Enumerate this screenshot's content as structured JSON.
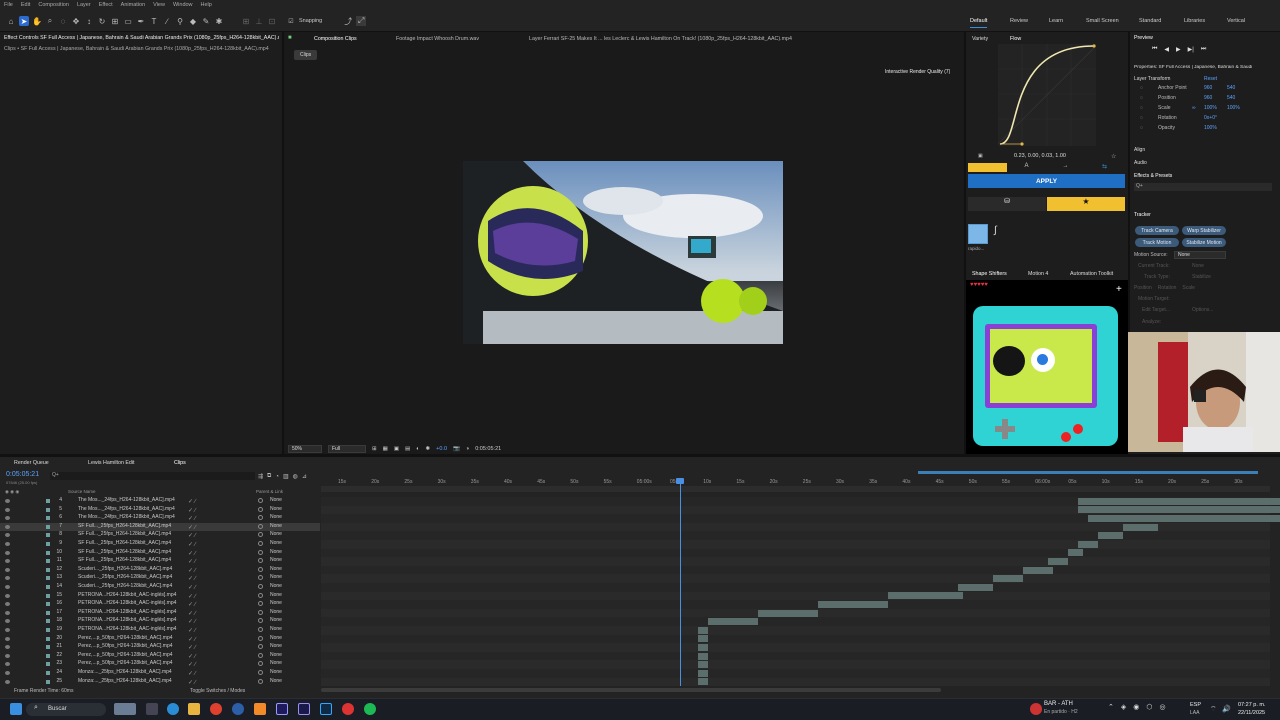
{
  "menu": [
    "File",
    "Edit",
    "Composition",
    "Layer",
    "Effect",
    "Animation",
    "View",
    "Window",
    "Help"
  ],
  "toolbar": {
    "snapping": "Snapping"
  },
  "workspaces": [
    "Default",
    "Review",
    "Learn",
    "Small Screen",
    "Standard",
    "Libraries",
    "Vertical"
  ],
  "effect_controls": {
    "tab": "Effect Controls SF Full Access | Japanese, Bahrain & Saudi Arabian Grands Prix (1080p_25fps_H264-128kbit_AAC).mp4",
    "path": "Clips • SF Full Access | Japanese, Bahrain & Saudi Arabian Grands Prix (1080p_25fps_H264-128kbit_AAC).mp4"
  },
  "viewer": {
    "tabs": [
      "Composition Clips",
      "Footage Impact Whoosh Drum.wav",
      "Layer Ferrari SF-25 Makes It ... les Leclerc & Lewis Hamilton On Track! (1080p_25fps_H264-128kbit_AAC).mp4"
    ],
    "breadcrumb": "Clips",
    "render_quality": "Interactive Render Quality (7)",
    "zoom": "50%",
    "resolution": "Full",
    "timecode": "0:05:05:21",
    "exposure": "+0.0"
  },
  "flow": {
    "tabs": [
      "Variety",
      "Flow"
    ],
    "values": "0.23, 0.00, 0.03, 1.00",
    "apply": "APPLY",
    "preset_label": "rapido..."
  },
  "preview": {
    "title": "Preview"
  },
  "properties": {
    "title": "Properties: SF Full Access | Japanese, Bahrain & Saudi",
    "section": "Layer Transform",
    "reset": "Reset",
    "rows": [
      {
        "label": "Anchor Point",
        "v1": "960",
        "v2": "540"
      },
      {
        "label": "Position",
        "v1": "960",
        "v2": "540"
      },
      {
        "label": "Scale",
        "v1": "100%",
        "v2": "100%"
      },
      {
        "label": "Rotation",
        "v1": "0x+0°",
        "v2": ""
      },
      {
        "label": "Opacity",
        "v1": "100%",
        "v2": ""
      }
    ],
    "align": "Align",
    "audio": "Audio",
    "effects_presets": "Effects & Presets",
    "search_placeholder": "Q+"
  },
  "tracker": {
    "title": "Tracker",
    "buttons": [
      "Track Camera",
      "Warp Stabilizer",
      "Track Motion",
      "Stabilize Motion"
    ],
    "motion_source_label": "Motion Source:",
    "motion_source": "None",
    "current_track_label": "Current Track:",
    "current_track": "None",
    "track_type_label": "Track Type:",
    "track_type": "Stabilize",
    "options": [
      "Position",
      "Rotation",
      "Scale"
    ],
    "motion_target": "Motion Target:",
    "edit_target": "Edit Target...",
    "options_btn": "Options...",
    "analyze": "Analyze:"
  },
  "lower_tabs": [
    "Shape Shifters",
    "Motion 4",
    "Automation Toolkit"
  ],
  "timeline": {
    "tabs": [
      "Render Queue",
      "Lewis Hamilton Edit",
      "Clips"
    ],
    "timecode": "0:05:05:21",
    "timecode_sub": "07646 (25.00 fps)",
    "search_placeholder": "Q+",
    "col_source": "Source Name",
    "col_parent": "Parent & Link",
    "ruler": [
      "15s",
      "20s",
      "25s",
      "30s",
      "35s",
      "40s",
      "45s",
      "50s",
      "55s",
      "05:00s",
      "05s",
      "10s",
      "15s",
      "20s",
      "25s",
      "30s",
      "35s",
      "40s",
      "45s",
      "50s",
      "55s",
      "06:00s",
      "05s",
      "10s",
      "15s",
      "20s",
      "25s",
      "30s"
    ],
    "layers": [
      {
        "n": "4",
        "name": "The Mos..._24fps_H264-128kbit_AAC].mp4",
        "parent": "None"
      },
      {
        "n": "5",
        "name": "The Mos..._24fps_H264-128kbit_AAC].mp4",
        "parent": "None"
      },
      {
        "n": "6",
        "name": "The Mos..._24fps_H264-128kbit_AAC].mp4",
        "parent": "None"
      },
      {
        "n": "7",
        "name": "SF Full..._25fps_H264-128kbit_AAC].mp4",
        "parent": "None"
      },
      {
        "n": "8",
        "name": "SF Full..._25fps_H264-128kbit_AAC].mp4",
        "parent": "None"
      },
      {
        "n": "9",
        "name": "SF Full..._25fps_H264-128kbit_AAC].mp4",
        "parent": "None"
      },
      {
        "n": "10",
        "name": "SF Full..._25fps_H264-128kbit_AAC].mp4",
        "parent": "None"
      },
      {
        "n": "11",
        "name": "SF Full..._25fps_H264-128kbit_AAC].mp4",
        "parent": "None"
      },
      {
        "n": "12",
        "name": "Scuderi..._25fps_H264-128kbit_AAC].mp4",
        "parent": "None"
      },
      {
        "n": "13",
        "name": "Scuderi..._25fps_H264-128kbit_AAC].mp4",
        "parent": "None"
      },
      {
        "n": "14",
        "name": "Scuderi..._25fps_H264-128kbit_AAC].mp4",
        "parent": "None"
      },
      {
        "n": "15",
        "name": "PETRONA...H264-128kbit_AAC-inglés].mp4",
        "parent": "None"
      },
      {
        "n": "16",
        "name": "PETRONA...H264-128kbit_AAC-inglés].mp4",
        "parent": "None"
      },
      {
        "n": "17",
        "name": "PETRONA...H264-128kbit_AAC-inglés].mp4",
        "parent": "None"
      },
      {
        "n": "18",
        "name": "PETRONA...H264-128kbit_AAC-inglés].mp4",
        "parent": "None"
      },
      {
        "n": "19",
        "name": "PETRONA...H264-128kbit_AAC-inglés].mp4",
        "parent": "None"
      },
      {
        "n": "20",
        "name": "Perez,...p_50fps_H264-128kbit_AAC].mp4",
        "parent": "None"
      },
      {
        "n": "21",
        "name": "Perez,...p_50fps_H264-128kbit_AAC].mp4",
        "parent": "None"
      },
      {
        "n": "22",
        "name": "Perez,...p_50fps_H264-128kbit_AAC].mp4",
        "parent": "None"
      },
      {
        "n": "23",
        "name": "Perez,...p_50fps_H264-128kbit_AAC].mp4",
        "parent": "None"
      },
      {
        "n": "24",
        "name": "Monza:..._25fps_H264-128kbit_AAC].mp4",
        "parent": "None"
      },
      {
        "n": "25",
        "name": "Monza:..._25fps_H264-128kbit_AAC].mp4",
        "parent": "None"
      }
    ],
    "footer_left": "Frame Render Time: 60ms",
    "footer_mid": "Toggle Switches / Modes"
  },
  "taskbar": {
    "search": "Buscar",
    "weather_title": "BAR - ATH",
    "weather_sub": "En partido · H2",
    "lang": "ESP",
    "lang_sub": "LAA",
    "time": "07:27 p. m.",
    "date": "22/11/2025"
  }
}
